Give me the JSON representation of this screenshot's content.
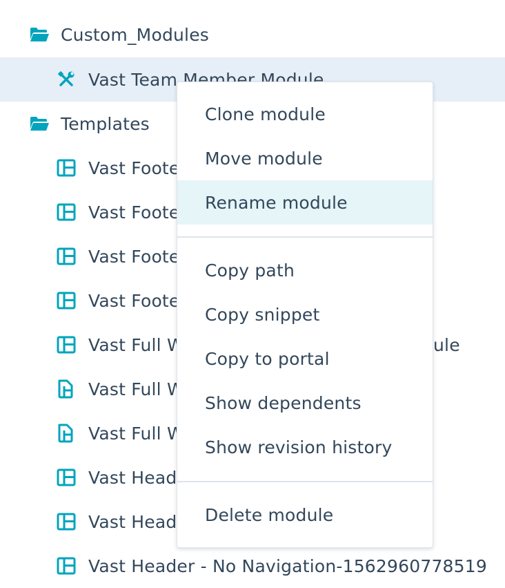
{
  "colors": {
    "icon_accent": "#00a4bd",
    "text": "#33475b",
    "selected_row_bg": "#e6eef7",
    "menu_hover_bg": "#e5f5f8",
    "divider": "#dfe3eb"
  },
  "tree": {
    "items": [
      {
        "label": "Custom_Modules",
        "icon": "folder-open-icon"
      },
      {
        "label": "Vast Team Member Module",
        "icon": "wrench-screwdriver-icon",
        "selected": true
      },
      {
        "label": "Templates",
        "icon": "folder-open-icon"
      },
      {
        "label": "Vast Foote",
        "icon": "layout-template-icon"
      },
      {
        "label": "Vast Foote",
        "icon": "layout-template-icon"
      },
      {
        "label": "Vast Foote",
        "icon": "layout-template-icon"
      },
      {
        "label": "Vast Foote",
        "icon": "layout-template-icon"
      },
      {
        "label": "Vast Full W",
        "icon": "layout-template-icon",
        "trailing_text": "ule"
      },
      {
        "label": "Vast Full W",
        "icon": "coded-file-icon"
      },
      {
        "label": "Vast Full W",
        "icon": "coded-file-icon"
      },
      {
        "label": "Vast Head",
        "icon": "layout-template-icon"
      },
      {
        "label": "Vast Head",
        "icon": "layout-template-icon"
      },
      {
        "label": "Vast Header - No Navigation-1562960778519",
        "icon": "layout-template-icon"
      }
    ]
  },
  "context_menu": {
    "groups": [
      [
        {
          "label": "Clone module"
        },
        {
          "label": "Move module"
        },
        {
          "label": "Rename module",
          "hovered": true
        }
      ],
      [
        {
          "label": "Copy path"
        },
        {
          "label": "Copy snippet"
        },
        {
          "label": "Copy to portal"
        },
        {
          "label": "Show dependents"
        },
        {
          "label": "Show revision history"
        }
      ],
      [
        {
          "label": "Delete module"
        }
      ]
    ]
  }
}
